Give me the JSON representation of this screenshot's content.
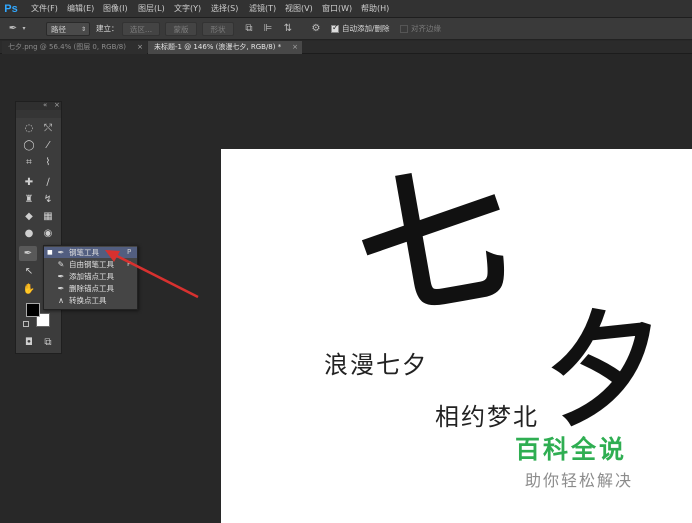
{
  "app": {
    "logo": "Ps"
  },
  "menubar": [
    {
      "label": "文件(F)"
    },
    {
      "label": "编辑(E)"
    },
    {
      "label": "图像(I)"
    },
    {
      "label": "图层(L)"
    },
    {
      "label": "文字(Y)"
    },
    {
      "label": "选择(S)"
    },
    {
      "label": "滤镜(T)"
    },
    {
      "label": "视图(V)"
    },
    {
      "label": "窗口(W)"
    },
    {
      "label": "帮助(H)"
    }
  ],
  "options": {
    "mode_value": "路径",
    "make_label": "建立：",
    "selection_btn": "选区...",
    "mask_btn": "蒙版",
    "shape_btn": "形状",
    "auto_add_delete_label": "自动添加/删除",
    "auto_add_delete_checked": true,
    "align_edges_label": "对齐边缘",
    "align_edges_checked": false
  },
  "tabs": [
    {
      "label": "七夕.png @ 56.4% (图层 0, RGB/8)",
      "active": false
    },
    {
      "label": "未标题-1 @ 146% (浪漫七夕, RGB/8) *",
      "active": true
    }
  ],
  "canvas": {
    "big_char_1": "七",
    "big_char_2": "夕",
    "line1": "浪漫七夕",
    "line2": "相约梦北"
  },
  "flyout": {
    "items": [
      {
        "label": "钢笔工具",
        "shortcut": "P",
        "icon": "pen-icon",
        "selected": true
      },
      {
        "label": "自由钢笔工具",
        "shortcut": "P",
        "icon": "freeform-pen-icon",
        "selected": false
      },
      {
        "label": "添加锚点工具",
        "shortcut": "",
        "icon": "add-anchor-icon",
        "selected": false
      },
      {
        "label": "删除锚点工具",
        "shortcut": "",
        "icon": "delete-anchor-icon",
        "selected": false
      },
      {
        "label": "转换点工具",
        "shortcut": "",
        "icon": "convert-point-icon",
        "selected": false
      }
    ]
  },
  "watermark": {
    "title": "百科全说",
    "subtitle": "助你轻松解决"
  },
  "colors": {
    "accent_arrow": "#d8312f",
    "watermark_green": "#2fae52",
    "flyout_highlight": "#525e80"
  }
}
